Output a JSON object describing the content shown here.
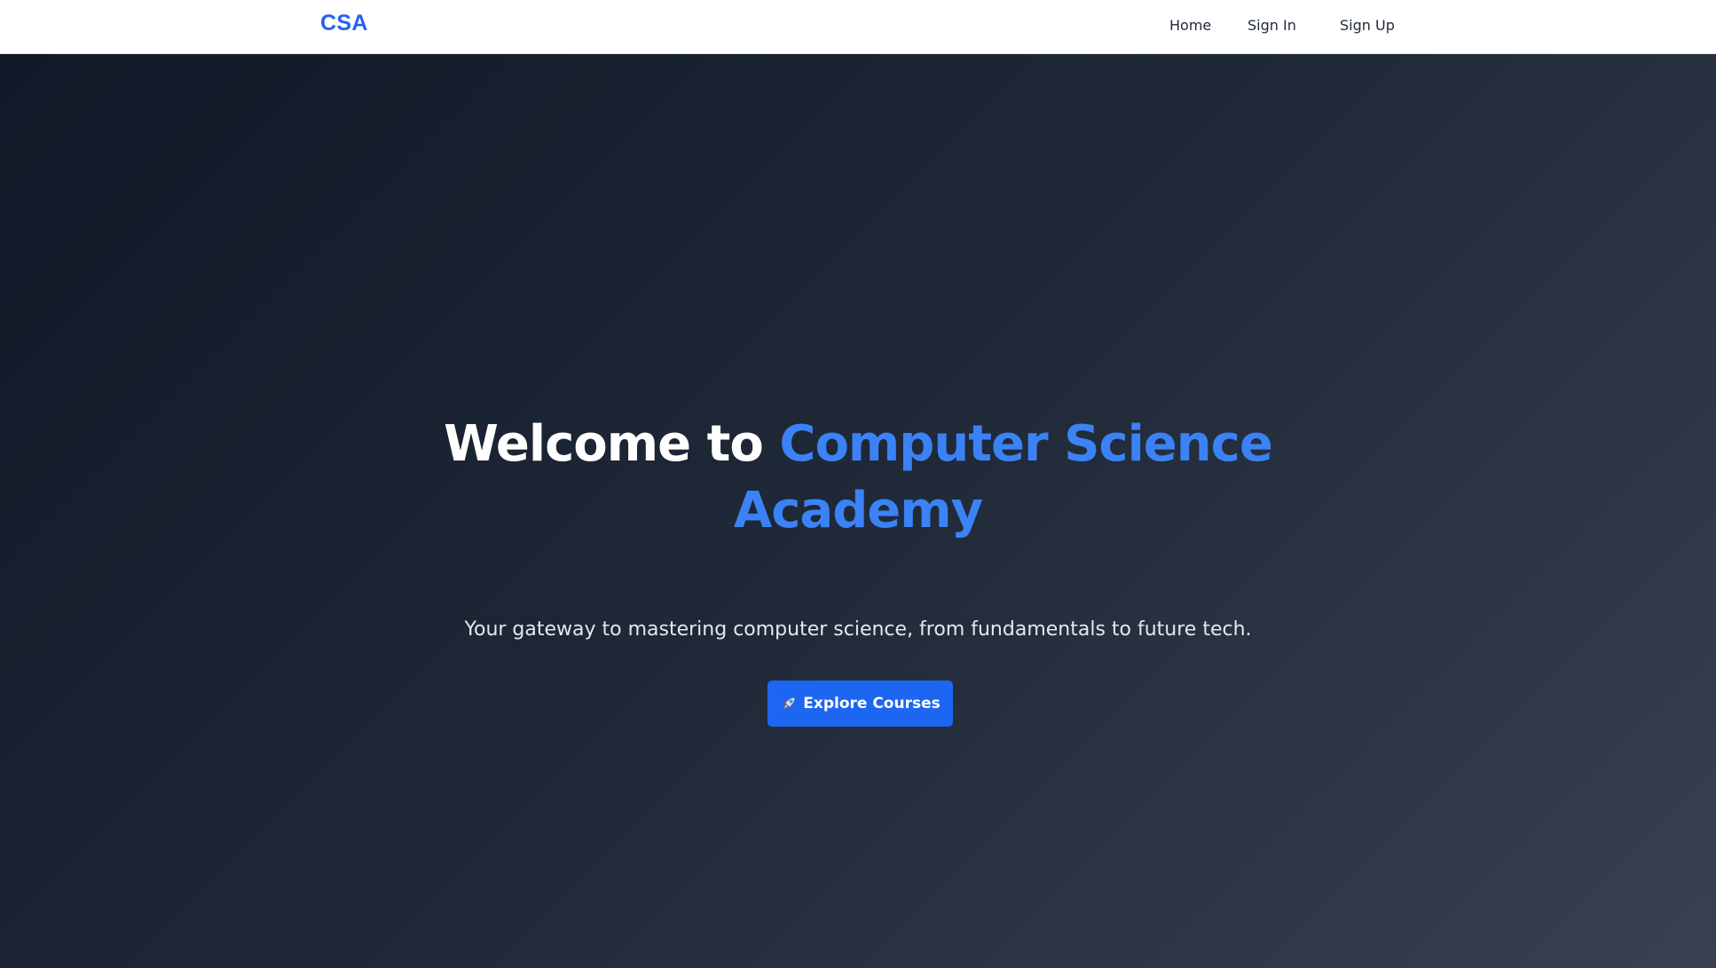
{
  "navbar": {
    "brand": "CSA",
    "links": [
      {
        "label": "Home"
      },
      {
        "label": "Sign In"
      },
      {
        "label": "Sign Up"
      }
    ]
  },
  "hero": {
    "title_prefix": "Welcome to ",
    "title_accent": "Computer Science Academy",
    "subtitle": "Your gateway to mastering computer science, from fundamentals to future tech.",
    "cta_label": "Explore Courses",
    "cta_icon": "rocket-icon"
  },
  "colors": {
    "accent": "#3b82f6",
    "brand": "#2563eb",
    "button": "#1d66f2",
    "hero_bg_start": "#111827",
    "hero_bg_end": "#374151",
    "nav_bg": "#ffffff"
  }
}
